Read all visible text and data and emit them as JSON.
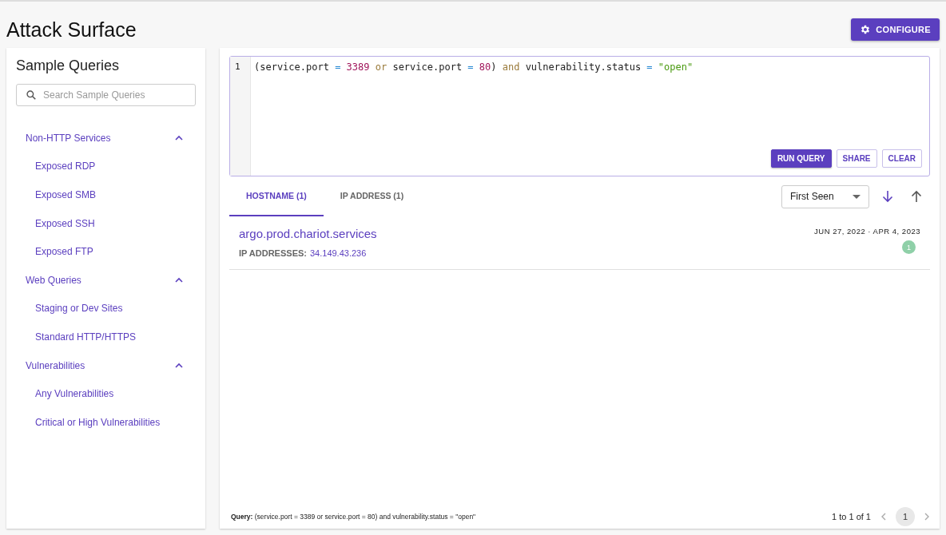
{
  "page_title": "Attack Surface",
  "configure_button": "CONFIGURE",
  "sidebar": {
    "title": "Sample Queries",
    "search": {
      "placeholder": "Search Sample Queries"
    },
    "groups": [
      {
        "label": "Non-HTTP Services",
        "expanded": true,
        "children": [
          {
            "label": "Exposed RDP"
          },
          {
            "label": "Exposed SMB"
          },
          {
            "label": "Exposed SSH"
          },
          {
            "label": "Exposed FTP"
          }
        ]
      },
      {
        "label": "Web Queries",
        "expanded": true,
        "children": [
          {
            "label": "Staging or Dev Sites"
          },
          {
            "label": "Standard HTTP/HTTPS"
          }
        ]
      },
      {
        "label": "Vulnerabilities",
        "expanded": true,
        "children": [
          {
            "label": "Any Vulnerabilities"
          },
          {
            "label": "Critical or High Vulnerabilities"
          }
        ]
      }
    ]
  },
  "editor": {
    "line_number": "1",
    "tokens": [
      {
        "kind": "plain",
        "text": "(service.port "
      },
      {
        "kind": "op",
        "text": "="
      },
      {
        "kind": "num",
        "text": " 3389"
      },
      {
        "kind": "kw",
        "text": " or "
      },
      {
        "kind": "plain",
        "text": "service.port "
      },
      {
        "kind": "op",
        "text": "="
      },
      {
        "kind": "num",
        "text": " 80"
      },
      {
        "kind": "plain",
        "text": ")"
      },
      {
        "kind": "kw",
        "text": " and "
      },
      {
        "kind": "plain",
        "text": "vulnerability.status "
      },
      {
        "kind": "op",
        "text": "="
      },
      {
        "kind": "str",
        "text": " \"open\""
      }
    ],
    "buttons": [
      {
        "label": "RUN QUERY",
        "kind": "primary"
      },
      {
        "label": "SHARE",
        "kind": "outlined"
      },
      {
        "label": "CLEAR",
        "kind": "outlined"
      }
    ]
  },
  "tabs": [
    {
      "label": "HOSTNAME (1)",
      "selected": true
    },
    {
      "label": "IP ADDRESS (1)",
      "selected": false
    }
  ],
  "sort": {
    "value": "First Seen",
    "directions": [
      {
        "kind": "down",
        "selected": true
      },
      {
        "kind": "up",
        "selected": false
      }
    ]
  },
  "results": [
    {
      "hostname": "argo.prod.chariot.services",
      "ip_label": "IP ADDRESSES:",
      "ip": "34.149.43.236",
      "dates": "JUN 27, 2022 · APR 4, 2023",
      "count": "1",
      "color": "#8fd0a8"
    }
  ],
  "footer": {
    "query": "**Query:** (service.port = 3389 or service.port = 80) and vulnerability.status = \"open\"",
    "range": "1 to 1 of 1",
    "pages": [
      {
        "label": "1",
        "selected": true
      }
    ]
  }
}
